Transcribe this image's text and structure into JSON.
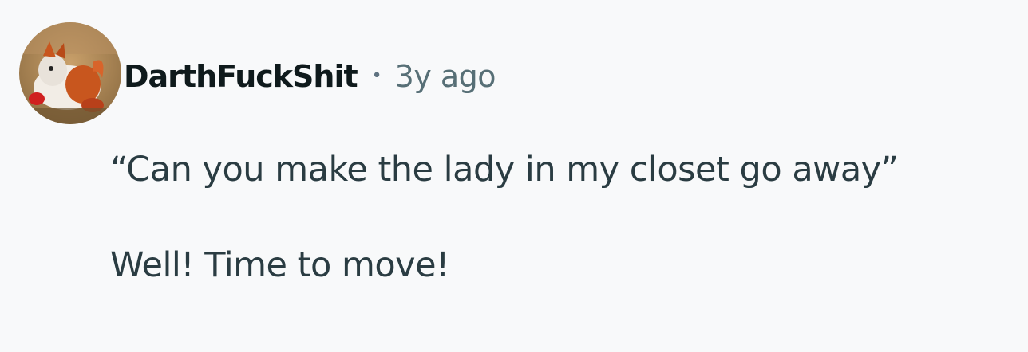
{
  "comment": {
    "username": "DarthFuckShit",
    "separator": "•",
    "timestamp": "3y ago",
    "avatar_icon": "user-avatar-icon",
    "paragraphs": [
      "“Can you make the lady in my closet go away”",
      "Well! Time to move!"
    ]
  },
  "colors": {
    "background": "#f8f9fa",
    "username": "#0f1a1c",
    "timestamp": "#576f76",
    "body_text": "#2a3c42"
  }
}
